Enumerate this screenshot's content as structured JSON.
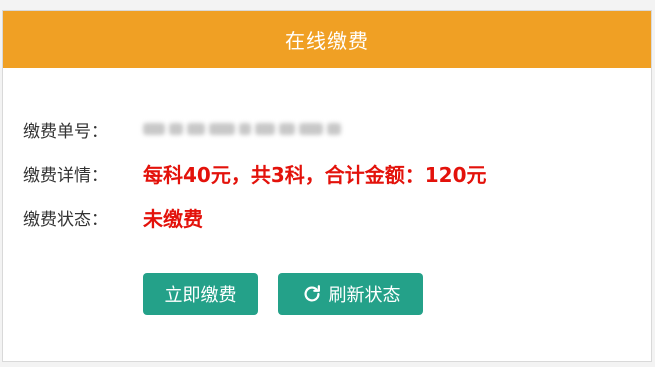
{
  "header": {
    "title": "在线缴费"
  },
  "fields": {
    "order_no_label": "缴费单号：",
    "details_label": "缴费详情：",
    "details_value": "每科40元，共3科，合计金额：120元",
    "status_label": "缴费状态：",
    "status_value": "未缴费"
  },
  "buttons": {
    "pay_label": "立即缴费",
    "refresh_label": "刷新状态",
    "refresh_icon": "refresh-icon"
  },
  "colors": {
    "header": "#f0a024",
    "button": "#24a189",
    "highlight": "#e3120b"
  }
}
